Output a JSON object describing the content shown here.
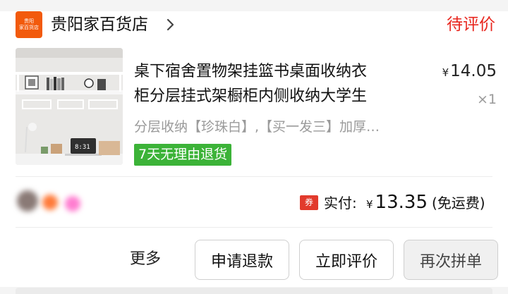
{
  "shop": {
    "logo_text_line1": "贵阳",
    "logo_text_line2": "家百货店",
    "name": "贵阳家百货店"
  },
  "order": {
    "status": "待评价",
    "item": {
      "title_line1": "桌下宿舍置物架挂篮书桌面收纳衣",
      "title_line2": "柜分层挂式架橱柜内侧收纳大学生",
      "currency": "¥",
      "price": "14.05",
      "quantity": "×1",
      "spec": "分层收纳【珍珠白】,【买一发三】加厚…",
      "return_policy": "7天无理由退货",
      "image_clock_text": "8:31"
    },
    "payment": {
      "coupon_badge": "券",
      "paid_label": "实付:",
      "currency": "¥",
      "amount": "13.35",
      "shipping_note": "(免运费)"
    },
    "actions": {
      "more": "更多",
      "refund": "申请退款",
      "review": "立即评价",
      "reorder": "再次拼单"
    }
  },
  "colors": {
    "accent_red": "#e8261e",
    "logo_orange": "#f25a0c",
    "return_green": "#3cb338",
    "coupon_red": "#e23a2c"
  }
}
